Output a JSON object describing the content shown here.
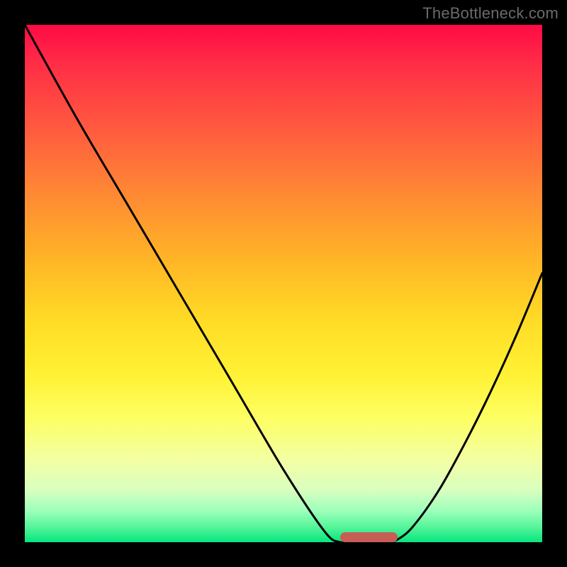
{
  "watermark": "TheBottleneck.com",
  "colors": {
    "curve_stroke": "#000000",
    "marker_fill": "#c65e55",
    "frame": "#000000"
  },
  "chart_data": {
    "type": "line",
    "title": "",
    "xlabel": "",
    "ylabel": "",
    "xlim": [
      0,
      100
    ],
    "ylim": [
      0,
      100
    ],
    "grid": false,
    "series": [
      {
        "name": "bottleneck-curve-left",
        "x": [
          0,
          10,
          20,
          30,
          40,
          50,
          58,
          61,
          63
        ],
        "y": [
          100,
          82,
          65,
          48,
          31,
          14,
          2,
          0,
          0
        ]
      },
      {
        "name": "bottleneck-curve-right",
        "x": [
          70,
          72,
          75,
          80,
          85,
          90,
          95,
          100
        ],
        "y": [
          0,
          0.5,
          3,
          10,
          19,
          29,
          40,
          52
        ]
      }
    ],
    "annotations": [
      {
        "name": "optimal-marker",
        "x_start": 61,
        "x_end": 72,
        "y": 0
      }
    ]
  }
}
